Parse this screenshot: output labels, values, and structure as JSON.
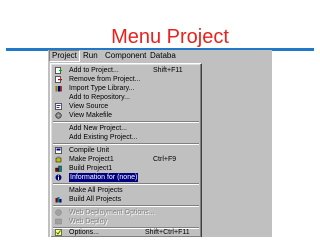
{
  "slide": {
    "title": "Menu Project"
  },
  "menubar": [
    "Project",
    "Run",
    "Component",
    "Databa"
  ],
  "menu": {
    "g1": [
      {
        "label": "Add to Project...",
        "shortcut": "Shift+F11",
        "icon": "add-file-icon"
      },
      {
        "label": "Remove from Project...",
        "shortcut": "",
        "icon": "remove-file-icon"
      },
      {
        "label": "Import Type Library...",
        "shortcut": "",
        "icon": "library-icon"
      },
      {
        "label": "Add to Repository...",
        "shortcut": "",
        "icon": ""
      },
      {
        "label": "View Source",
        "shortcut": "",
        "icon": "source-icon"
      },
      {
        "label": "View Makefile",
        "shortcut": "",
        "icon": "makefile-icon"
      }
    ],
    "g2": [
      {
        "label": "Add New Project...",
        "shortcut": "",
        "icon": ""
      },
      {
        "label": "Add Existing Project...",
        "shortcut": "",
        "icon": ""
      }
    ],
    "g3": [
      {
        "label": "Compile Unit",
        "shortcut": "",
        "icon": "compile-icon"
      },
      {
        "label": "Make Project1",
        "shortcut": "Ctrl+F9",
        "icon": "make-icon"
      },
      {
        "label": "Build Project1",
        "shortcut": "",
        "icon": "build-icon"
      },
      {
        "label": "Information for (none)",
        "shortcut": "",
        "icon": "info-icon"
      }
    ],
    "g4": [
      {
        "label": "Make All Projects",
        "shortcut": "",
        "icon": ""
      },
      {
        "label": "Build All Projects",
        "shortcut": "",
        "icon": "build-all-icon"
      }
    ],
    "g5": [
      {
        "label": "Web Deployment Options...",
        "shortcut": "",
        "icon": "web-options-icon"
      },
      {
        "label": "Web Deploy",
        "shortcut": "",
        "icon": "web-deploy-icon"
      }
    ],
    "g6": [
      {
        "label": "Options...",
        "shortcut": "Shift+Ctrl+F11",
        "icon": "options-icon"
      }
    ]
  }
}
